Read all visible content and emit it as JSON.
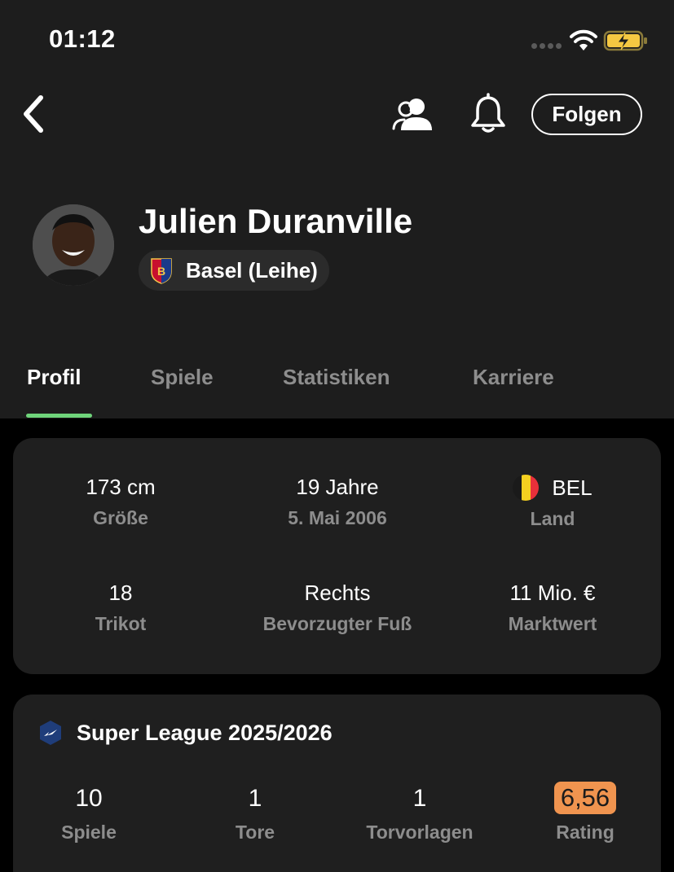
{
  "status_bar": {
    "time": "01:12"
  },
  "nav": {
    "follow_label": "Folgen"
  },
  "player": {
    "name": "Julien Duranville",
    "club": "Basel (Leihe)"
  },
  "tabs": [
    {
      "label": "Profil",
      "active": true
    },
    {
      "label": "Spiele",
      "active": false
    },
    {
      "label": "Statistiken",
      "active": false
    },
    {
      "label": "Karriere",
      "active": false
    }
  ],
  "info": {
    "height": {
      "value": "173 cm",
      "label": "Größe"
    },
    "age": {
      "value": "19 Jahre",
      "label": "5. Mai 2006"
    },
    "country": {
      "value": "BEL",
      "label": "Land"
    },
    "shirt": {
      "value": "18",
      "label": "Trikot"
    },
    "foot": {
      "value": "Rechts",
      "label": "Bevorzugter Fuß"
    },
    "market_value": {
      "value": "11 Mio. €",
      "label": "Marktwert"
    }
  },
  "league": {
    "title": "Super League 2025/2026",
    "stats": [
      {
        "value": "10",
        "label": "Spiele"
      },
      {
        "value": "1",
        "label": "Tore"
      },
      {
        "value": "1",
        "label": "Torvorlagen"
      },
      {
        "value": "6,56",
        "label": "Rating"
      }
    ]
  },
  "colors": {
    "accent_green": "#6fd47a",
    "rating_badge": "#f0944f",
    "battery_yellow": "#f5c842"
  }
}
